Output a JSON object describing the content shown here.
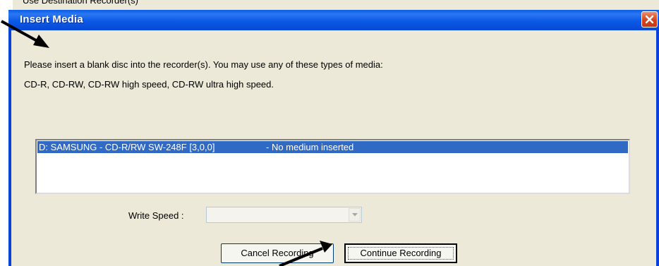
{
  "background_window": {
    "partial_text": "Use Destination Recorder(s)"
  },
  "dialog": {
    "title": "Insert Media",
    "message_line1": "Please insert a blank disc into the recorder(s). You may use any of these types of media:",
    "message_line2": "CD-R, CD-RW, CD-RW high speed, CD-RW ultra high speed.",
    "recorders": [
      {
        "drive": "D: SAMSUNG - CD-R/RW SW-248F [3,0,0]",
        "status": "- No medium inserted",
        "selected": true
      }
    ],
    "write_speed": {
      "label": "Write Speed :",
      "value": "",
      "disabled": true
    },
    "buttons": {
      "cancel": "Cancel Recording",
      "continue": "Continue Recording"
    }
  },
  "icons": {
    "close": "close-icon",
    "dropdown": "chevron-down-icon"
  },
  "colors": {
    "titlebar": "#0b5ae5",
    "selection": "#316ac5",
    "close_button": "#d3431b",
    "dialog_background": "#ece9d8"
  }
}
